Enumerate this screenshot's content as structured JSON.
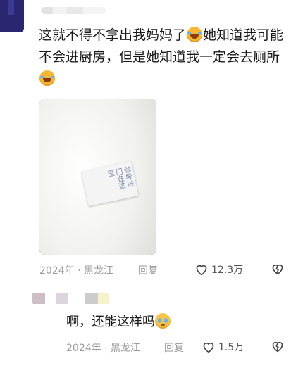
{
  "comment": {
    "text_1": "这就不得不拿出我妈妈了",
    "text_2": "她知道我可能不会进厨房，但是她知道我一定会去厕所",
    "emoji": "laughing-crying-emoji",
    "image_note": "领导进门在这里",
    "date": "2024年 · 黑龙江",
    "reply_label": "回复",
    "likes": "12.3万"
  },
  "reply": {
    "text": "啊，还能这样吗",
    "emoji": "pleading-crying-emoji",
    "date": "2024年 · 黑龙江",
    "reply_label": "回复",
    "likes": "1.5万"
  },
  "colors": {
    "avatar": "#2a2770",
    "meta_text": "#9a9a9a",
    "body_text": "#1a1a1a"
  }
}
